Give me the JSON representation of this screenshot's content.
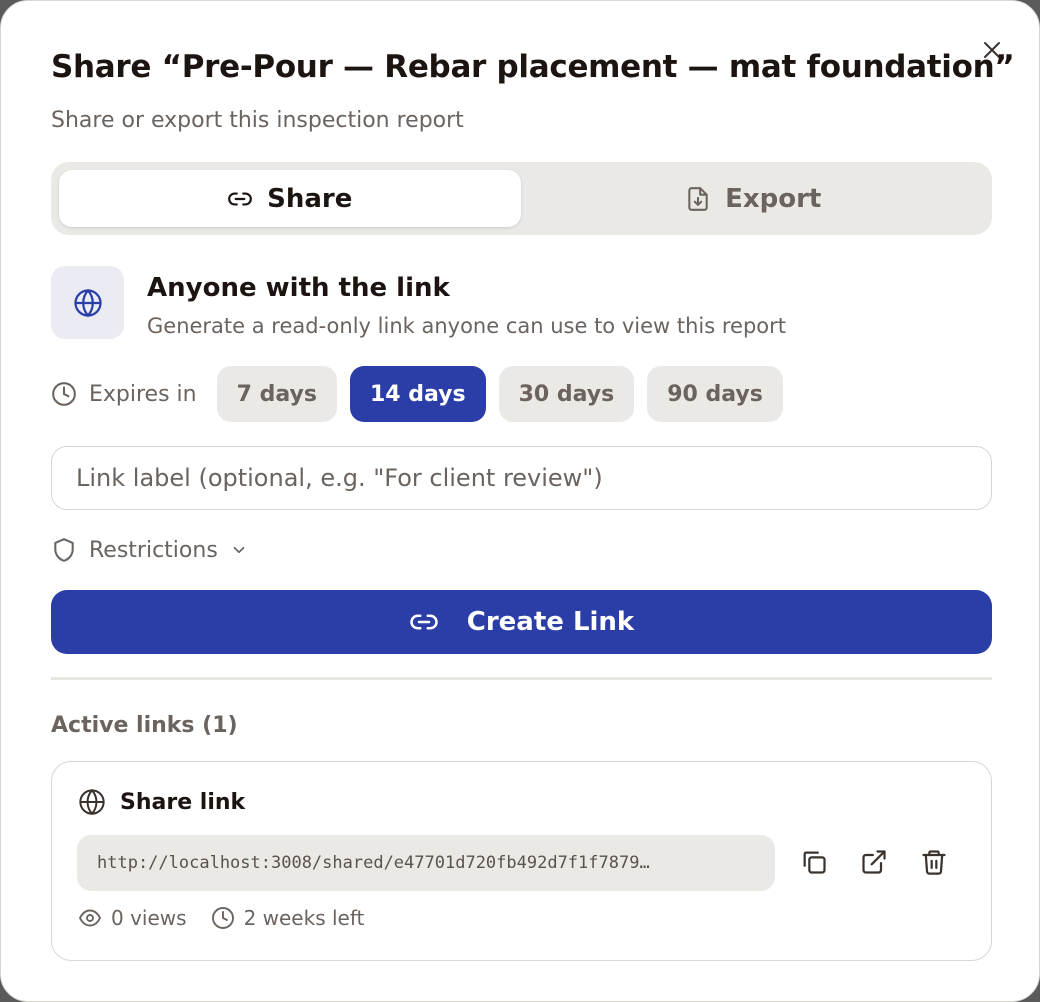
{
  "dialog": {
    "title": "Share “Pre-Pour — Rebar placement — mat foundation”",
    "subtitle": "Share or export this inspection report"
  },
  "tabs": [
    {
      "label": "Share",
      "icon": "link-icon",
      "active": true
    },
    {
      "label": "Export",
      "icon": "file-download-icon",
      "active": false
    }
  ],
  "share_option": {
    "icon": "globe-icon",
    "title": "Anyone with the link",
    "description": "Generate a read-only link anyone can use to view this report"
  },
  "expires": {
    "label": "Expires in",
    "options": [
      "7 days",
      "14 days",
      "30 days",
      "90 days"
    ],
    "selected": "14 days"
  },
  "link_label": {
    "value": "",
    "placeholder": "Link label (optional, e.g. \"For client review\")"
  },
  "restrictions": {
    "label": "Restrictions"
  },
  "create_button": {
    "label": "Create Link"
  },
  "active_links": {
    "heading": "Active links (1)",
    "items": [
      {
        "title": "Share link",
        "url": "http://localhost:3008/shared/e47701d720fb492d7f1f7879…",
        "views": "0 views",
        "time_left": "2 weeks left"
      }
    ]
  },
  "colors": {
    "accent": "#2b3ea8",
    "muted_text": "#6b635e",
    "surface": "#ebe9e5"
  }
}
